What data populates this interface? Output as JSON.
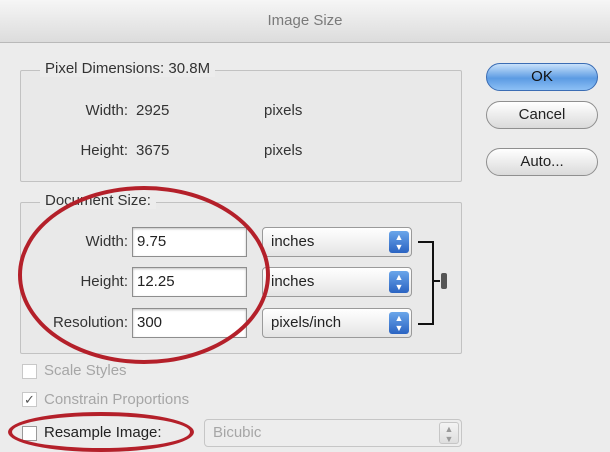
{
  "window": {
    "title": "Image Size"
  },
  "pixel_dimensions": {
    "legend": "Pixel Dimensions:",
    "size": "30.8M",
    "width_label": "Width:",
    "width_value": "2925",
    "width_unit": "pixels",
    "height_label": "Height:",
    "height_value": "3675",
    "height_unit": "pixels"
  },
  "document_size": {
    "legend": "Document Size:",
    "width_label": "Width:",
    "width_value": "9.75",
    "width_unit": "inches",
    "height_label": "Height:",
    "height_value": "12.25",
    "height_unit": "inches",
    "resolution_label": "Resolution:",
    "resolution_value": "300",
    "resolution_unit": "pixels/inch"
  },
  "buttons": {
    "ok": "OK",
    "cancel": "Cancel",
    "auto": "Auto..."
  },
  "options": {
    "scale_styles": {
      "label": "Scale Styles",
      "checked": false,
      "enabled": false
    },
    "constrain_proportions": {
      "label": "Constrain Proportions",
      "checked": true,
      "enabled": false
    },
    "resample_image": {
      "label": "Resample Image:",
      "checked": false,
      "enabled": true
    },
    "resample_method": "Bicubic"
  },
  "icons": {
    "select_arrows": "⬍",
    "checkmark": "✓",
    "link": "chain-link-icon"
  },
  "colors": {
    "annotation": "#b4202a",
    "default_button": "#5c9be3",
    "select_arrow": "#2a63c2"
  }
}
